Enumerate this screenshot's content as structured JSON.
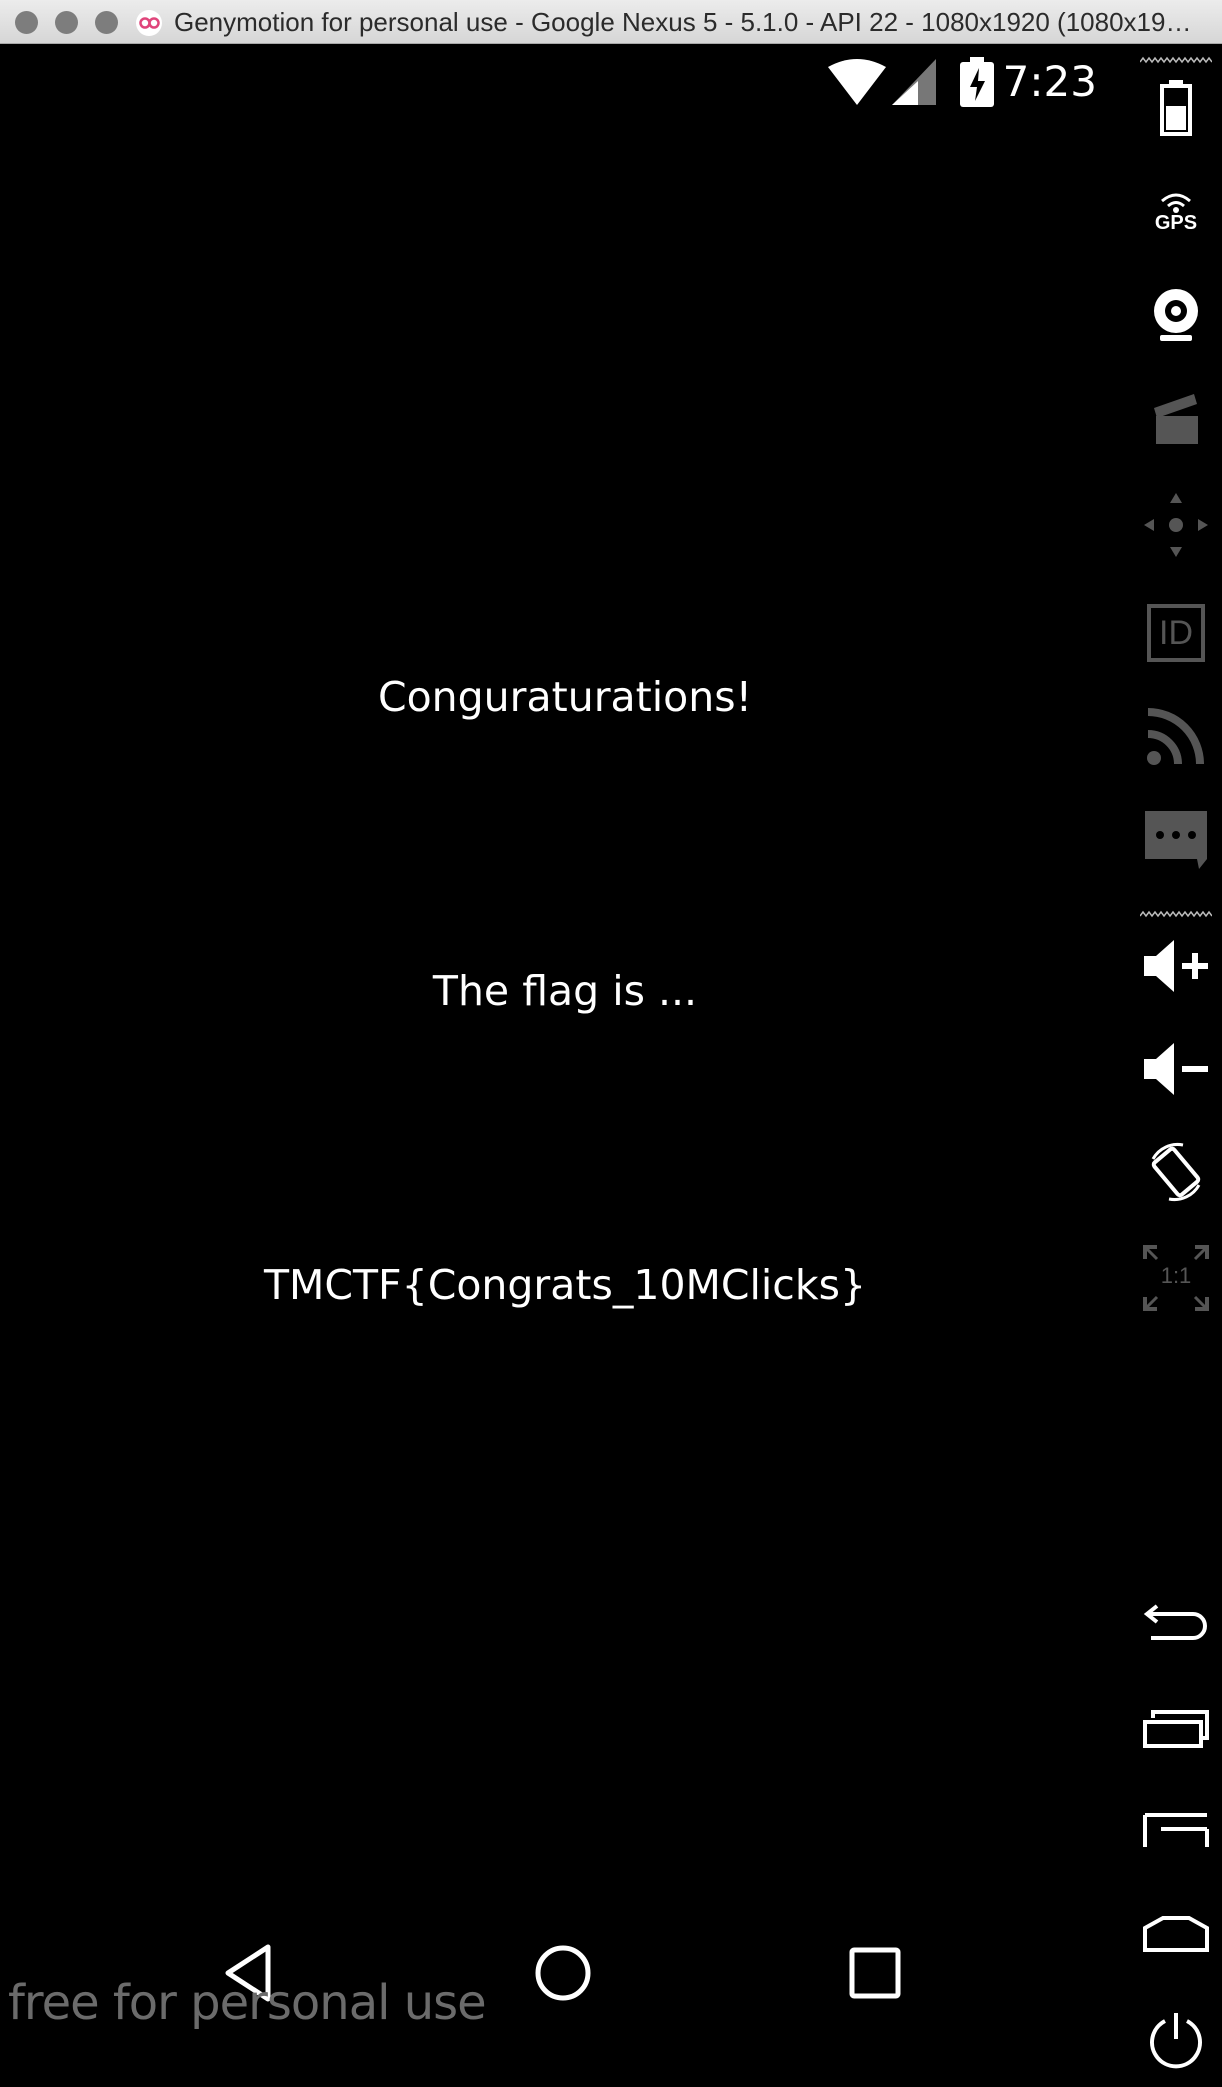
{
  "window": {
    "title": "Genymotion for personal use - Google Nexus 5 - 5.1.0 - API 22 - 1080x1920 (1080x1920, 480dpi) - 192.168.56.101"
  },
  "status_bar": {
    "time": "7:23",
    "icons": [
      "wifi-icon",
      "cell-signal-icon",
      "battery-charging-icon"
    ]
  },
  "content": {
    "line1": "Conguraturations!",
    "line2": "The flag is ...",
    "line3": "TMCTF{Congrats_10MClicks}"
  },
  "nav_bar": {
    "icons": [
      "back-icon",
      "home-icon",
      "recents-icon"
    ]
  },
  "watermark": "free for personal use",
  "sidebar": {
    "gps_label": "GPS",
    "id_label": "ID",
    "pixel_label": "1:1",
    "items": [
      "battery-icon",
      "gps-icon",
      "webcam-icon",
      "screencast-icon",
      "dpad-icon",
      "device-id-icon",
      "network-icon",
      "sms-icon",
      "volume-up-icon",
      "volume-down-icon",
      "rotate-icon",
      "pixel-perfect-icon",
      "back-icon",
      "recent-apps-icon",
      "menu-icon",
      "home-icon",
      "power-icon"
    ]
  }
}
